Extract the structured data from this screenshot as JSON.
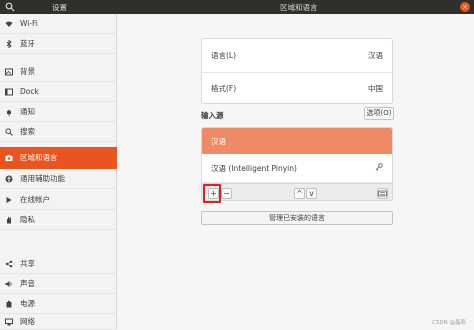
{
  "titlebar": {
    "sidebar_title": "设置",
    "main_title": "区域和语言",
    "close_glyph": "×"
  },
  "sidebar": {
    "items": [
      {
        "label": "Wi-Fi",
        "icon": "wifi-icon"
      },
      {
        "label": "蓝牙",
        "icon": "bluetooth-icon"
      },
      {
        "label": "背景",
        "icon": "background-icon"
      },
      {
        "label": "Dock",
        "icon": "dock-icon"
      },
      {
        "label": "通知",
        "icon": "bell-icon"
      },
      {
        "label": "搜索",
        "icon": "search-icon"
      },
      {
        "label": "区域和语言",
        "icon": "camera-icon",
        "active": true
      },
      {
        "label": "通用辅助功能",
        "icon": "accessibility-icon"
      },
      {
        "label": "在线帐户",
        "icon": "online-accounts-icon"
      },
      {
        "label": "隐私",
        "icon": "hand-icon"
      },
      {
        "label": "共享",
        "icon": "share-icon"
      },
      {
        "label": "声音",
        "icon": "sound-icon"
      },
      {
        "label": "电源",
        "icon": "power-icon"
      },
      {
        "label": "网络",
        "icon": "network-icon"
      }
    ]
  },
  "region": {
    "language_label": "语言(L)",
    "language_value": "汉语",
    "formats_label": "格式(F)",
    "formats_value": "中国"
  },
  "input_sources": {
    "heading": "输入源",
    "options_button": "选项(O)",
    "items": [
      {
        "label": "汉语",
        "selected": true
      },
      {
        "label": "汉语 (Intelligent Pinyin)",
        "has_settings": true
      }
    ],
    "add_glyph": "+",
    "remove_glyph": "−",
    "up_glyph": "^",
    "down_glyph": "v"
  },
  "manage_button": "管理已安装的语言",
  "watermark": "CSDN @晶彩",
  "colors": {
    "accent": "#e95420",
    "selected_row": "#ef8b64",
    "titlebar": "#2f2f2b",
    "highlight": "#e02020"
  }
}
